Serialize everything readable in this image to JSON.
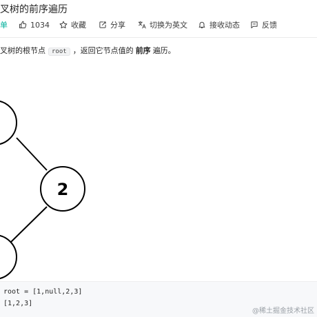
{
  "problem": {
    "title": "叉树的前序遍历"
  },
  "toolbar": {
    "difficulty": "单",
    "likes": "1034",
    "favorite": "收藏",
    "share": "分享",
    "translate": "切换为英文",
    "notify": "接收动态",
    "feedback": "反馈"
  },
  "description": {
    "part1": "叉树的根节点",
    "code": "root",
    "part2": "，返回它节点值的",
    "bold": "前序",
    "part3": "遍历。"
  },
  "tree": {
    "nodes": [
      {
        "label": ""
      },
      {
        "label": "2"
      },
      {
        "label": ""
      }
    ]
  },
  "example": {
    "input": "root = [1,null,2,3]",
    "output": "[1,2,3]"
  },
  "watermark": "@稀土掘金技术社区"
}
